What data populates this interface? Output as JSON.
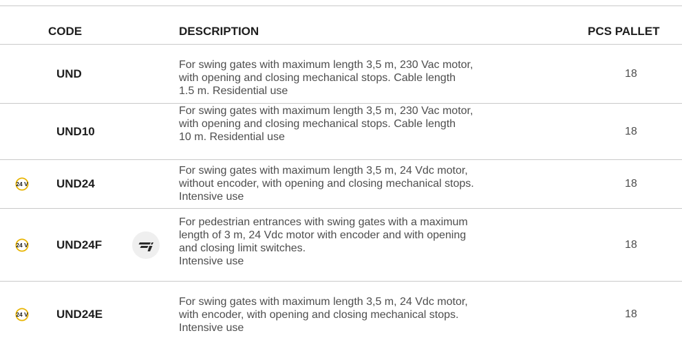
{
  "header": {
    "code": "CODE",
    "description": "DESCRIPTION",
    "pcs_pallet": "PCS PALLET"
  },
  "rows": [
    {
      "code": "UND",
      "description_lines": [
        "For swing gates with maximum length 3,5 m, 230 Vac motor,",
        "with opening and closing mechanical stops. Cable length",
        "1.5 m. Residential use"
      ],
      "pcs": "18",
      "badge": null,
      "icon": null
    },
    {
      "code": "UND10",
      "description_lines": [
        "For swing gates with maximum length 3,5 m, 230 Vac motor,",
        "with opening and closing mechanical stops. Cable length",
        "10 m. Residential use"
      ],
      "pcs": "18",
      "badge": null,
      "icon": null
    },
    {
      "code": "UND24",
      "description_lines": [
        "For swing gates with maximum length 3,5 m, 24 Vdc motor,",
        "without encoder, with opening and closing mechanical stops.",
        "Intensive use"
      ],
      "pcs": "18",
      "badge": "24 V",
      "icon": null
    },
    {
      "code": "UND24F",
      "description_lines": [
        "For pedestrian entrances with swing gates with a maximum",
        "length of 3 m, 24 Vdc motor with encoder and with opening",
        "and closing limit switches.",
        "Intensive use"
      ],
      "pcs": "18",
      "badge": "24 V",
      "icon": "fast-motion-icon"
    },
    {
      "code": "UND24E",
      "description_lines": [
        "For swing gates with maximum length 3,5 m, 24 Vdc motor,",
        "with encoder, with opening and closing mechanical stops.",
        "Intensive use"
      ],
      "pcs": "18",
      "badge": "24 V",
      "icon": null
    }
  ],
  "colors": {
    "badge_ring": "#e8b400",
    "badge_text": "#1e1e1e",
    "rule": "#c8c8c8"
  }
}
